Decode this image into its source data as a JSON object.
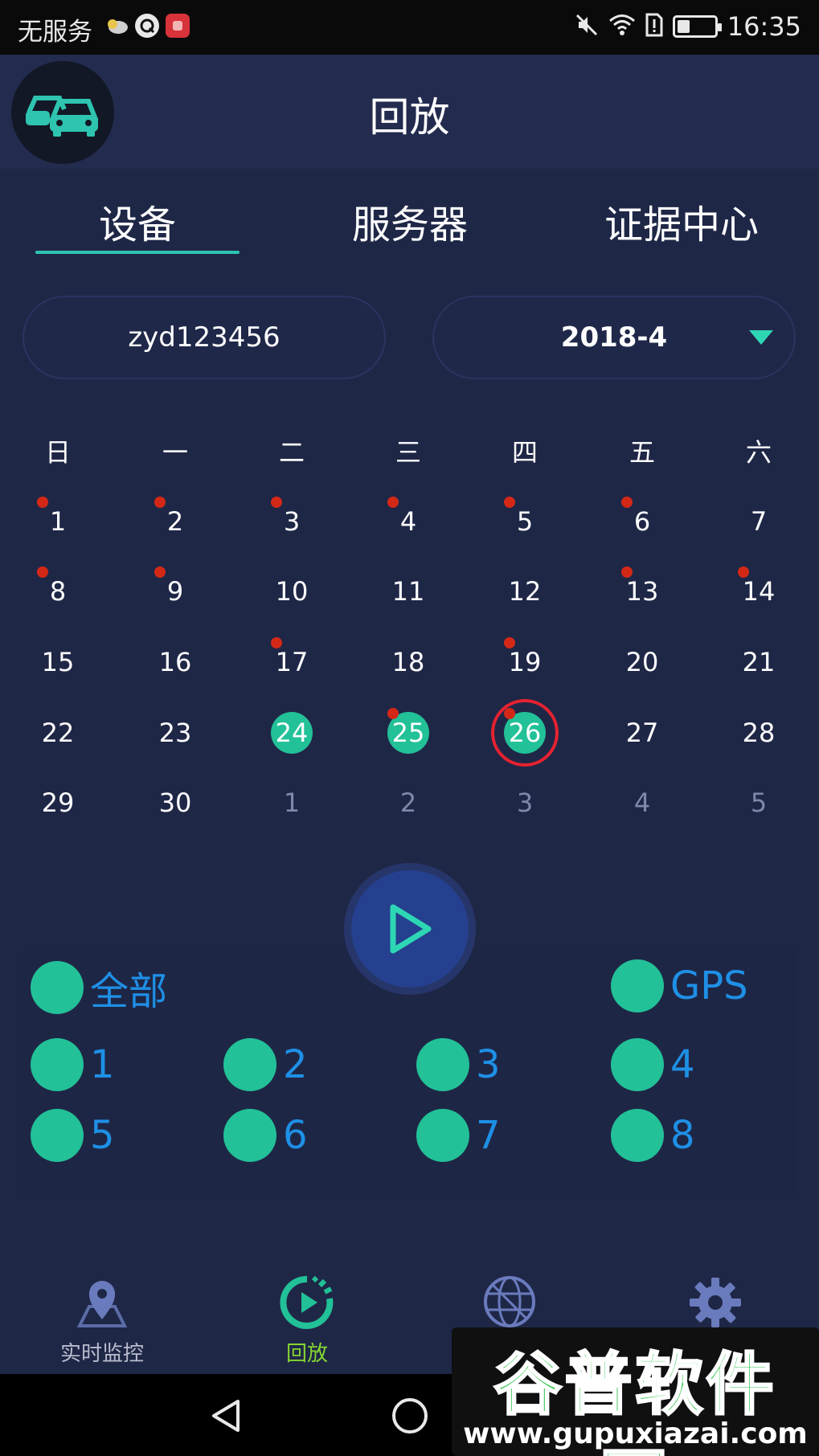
{
  "status_bar": {
    "carrier": "无服务",
    "time": "16:35",
    "battery_level": 0.35
  },
  "header": {
    "title": "回放",
    "logo_icon": "cars-icon"
  },
  "tabs": [
    {
      "label": "设备",
      "active": true
    },
    {
      "label": "服务器",
      "active": false
    },
    {
      "label": "证据中心",
      "active": false
    }
  ],
  "selectors": {
    "device": "zyd123456",
    "month": "2018-4"
  },
  "calendar": {
    "weekdays": [
      "日",
      "一",
      "二",
      "三",
      "四",
      "五",
      "六"
    ],
    "weeks": [
      [
        {
          "d": "1",
          "dot": true
        },
        {
          "d": "2",
          "dot": true
        },
        {
          "d": "3",
          "dot": true
        },
        {
          "d": "4",
          "dot": true
        },
        {
          "d": "5",
          "dot": true
        },
        {
          "d": "6",
          "dot": true
        },
        {
          "d": "7"
        }
      ],
      [
        {
          "d": "8",
          "dot": true
        },
        {
          "d": "9",
          "dot": true
        },
        {
          "d": "10"
        },
        {
          "d": "11"
        },
        {
          "d": "12"
        },
        {
          "d": "13",
          "dot": true
        },
        {
          "d": "14",
          "dot": true
        }
      ],
      [
        {
          "d": "15"
        },
        {
          "d": "16"
        },
        {
          "d": "17",
          "dot": true
        },
        {
          "d": "18"
        },
        {
          "d": "19",
          "dot": true
        },
        {
          "d": "20"
        },
        {
          "d": "21"
        }
      ],
      [
        {
          "d": "22"
        },
        {
          "d": "23"
        },
        {
          "d": "24",
          "selected": true
        },
        {
          "d": "25",
          "selected": true,
          "dot": true
        },
        {
          "d": "26",
          "selected": true,
          "dot": true,
          "today": true
        },
        {
          "d": "27"
        },
        {
          "d": "28"
        }
      ],
      [
        {
          "d": "29"
        },
        {
          "d": "30"
        },
        {
          "d": "1",
          "muted": true
        },
        {
          "d": "2",
          "muted": true
        },
        {
          "d": "3",
          "muted": true
        },
        {
          "d": "4",
          "muted": true
        },
        {
          "d": "5",
          "muted": true
        }
      ]
    ]
  },
  "channels": {
    "all_label": "全部",
    "gps_label": "GPS",
    "items": [
      "1",
      "2",
      "3",
      "4",
      "5",
      "6",
      "7",
      "8"
    ]
  },
  "bottom_nav": [
    {
      "label": "实时监控",
      "icon": "map-pin-icon",
      "active": false
    },
    {
      "label": "回放",
      "icon": "playback-icon",
      "active": true
    },
    {
      "label": "",
      "icon": "globe-icon",
      "active": false
    },
    {
      "label": "",
      "icon": "gear-icon",
      "active": false
    }
  ],
  "watermark": {
    "title": "谷普软件园",
    "url": "www.gupuxiazai.com"
  },
  "colors": {
    "background": "#1f2747",
    "accent": "#22c197",
    "channel_text": "#1e90e6",
    "record_dot": "#d42817",
    "today_ring": "#e52231",
    "nav_active": "#84d630"
  }
}
